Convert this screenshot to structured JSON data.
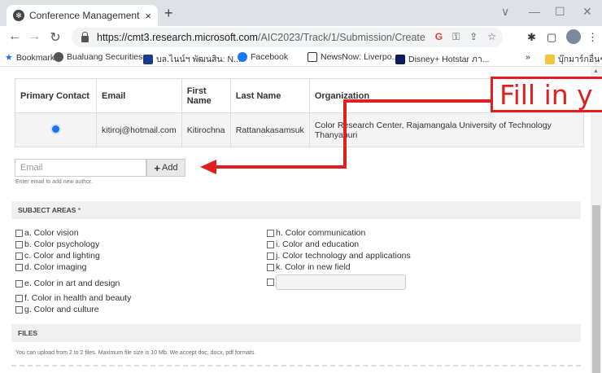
{
  "browser": {
    "tab_title": "Conference Management Toolkit",
    "tab_close": "×",
    "new_tab": "+",
    "win_min": "∨",
    "win_minimize": "—",
    "win_max": "☐",
    "win_close": "✕",
    "url_host": "https://cmt3.research.microsoft.com",
    "url_path": "/AIC2023/Track/1/Submission/Create",
    "omni_g": "G",
    "bookmarks": [
      {
        "label": "Bookmarks",
        "color": "#1a73e8"
      },
      {
        "label": "Bualuang Securities...",
        "color": "#555555"
      },
      {
        "label": "บล.ไนน์ฯ พัฒนสิน: N...",
        "color": "#1a3a8a"
      },
      {
        "label": "Facebook",
        "color": "#1877f2"
      },
      {
        "label": "NewsNow: Liverpo...",
        "color": "#333333"
      },
      {
        "label": "Disney+ Hotstar ภา...",
        "color": "#0a1a5a"
      }
    ],
    "bookmarks_more": "»",
    "other_bookmarks": "บุ๊กมาร์กอื่นๆ"
  },
  "authors": {
    "columns": [
      "Primary Contact",
      "Email",
      "First Name",
      "Last Name",
      "Organization"
    ],
    "rows": [
      {
        "email": "kitiroj@hotmail.com",
        "first_name": "Kitirochna",
        "last_name": "Rattanakasamsuk",
        "organization": "Color Research Center, Rajamangala University of Technology Thanyaburi"
      }
    ]
  },
  "add_author": {
    "placeholder": "Email",
    "button_label": "Add",
    "hint": "Enter email to add new author."
  },
  "subject_areas": {
    "title": "SUBJECT AREAS",
    "required_mark": "*",
    "left": [
      "a. Color vision",
      "b. Color psychology",
      "c. Color and lighting",
      "d. Color imaging",
      "e. Color in art and design",
      "f. Color in health and beauty",
      "g. Color and culture"
    ],
    "right": [
      "h. Color communication",
      "i. Color and education",
      "j. Color technology and applications",
      "k. Color in new field"
    ]
  },
  "files": {
    "title": "FILES",
    "hint": "You can upload from 2 to 2 files. Maximum file size is 10 Mb. We accept doc, docx, pdf formats."
  },
  "annotation": {
    "text": "Fill in y",
    "color": "#e02020"
  }
}
